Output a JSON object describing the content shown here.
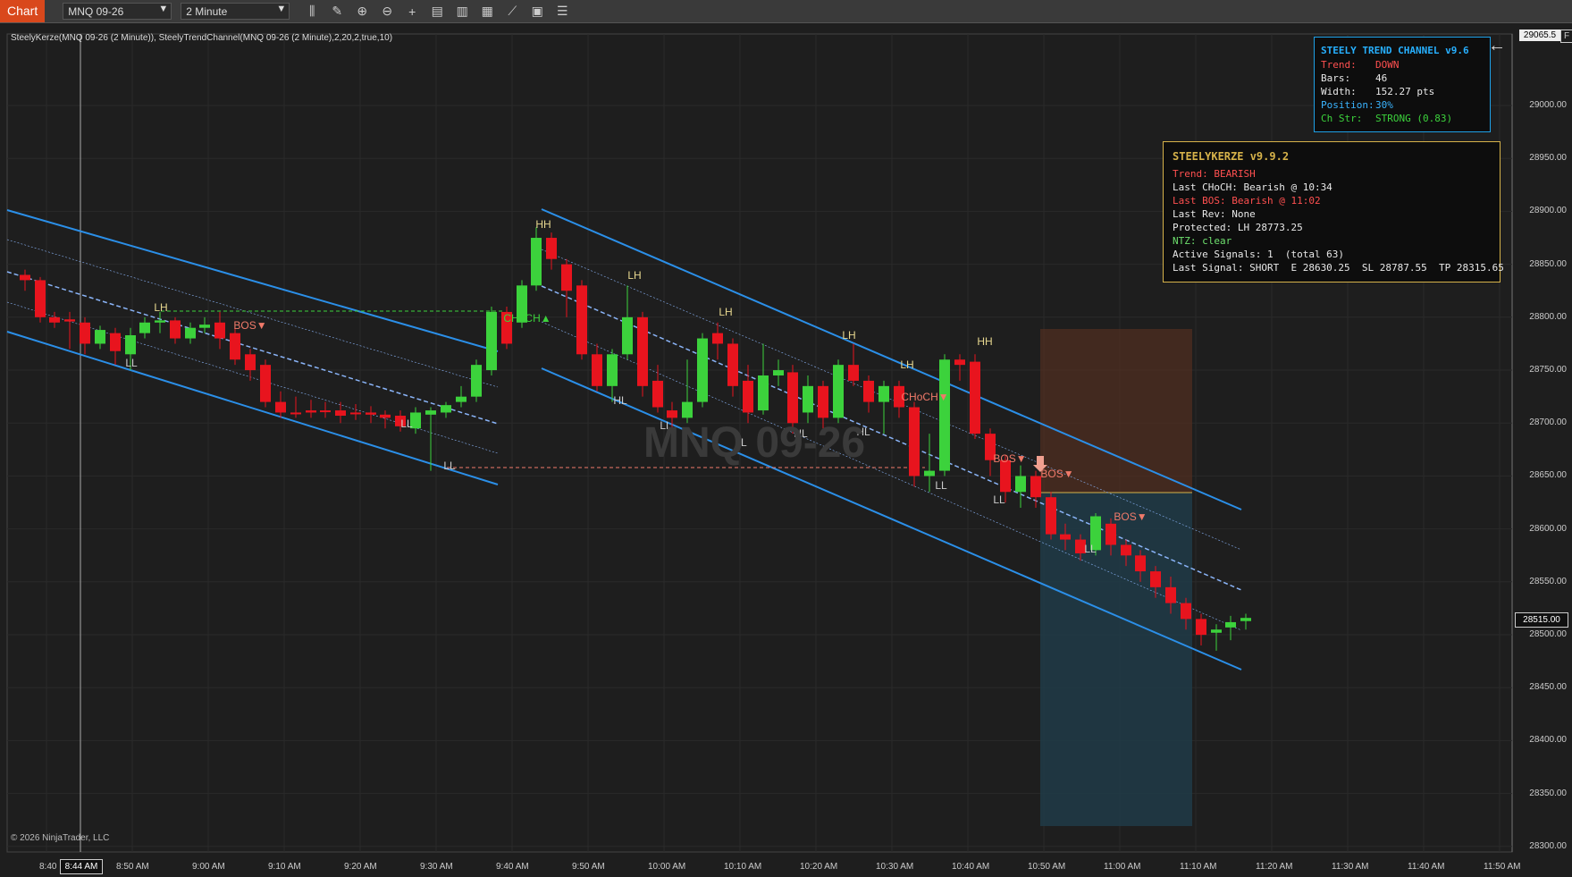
{
  "toolbar": {
    "tab": "Chart",
    "instrument": "MNQ 09-26",
    "interval": "2 Minute",
    "icons": [
      "bar-type-icon",
      "drawing-tool-icon",
      "zoom-in-icon",
      "zoom-out-icon",
      "crosshair-icon",
      "data-box-icon",
      "chart-trader-icon",
      "strategies-icon",
      "indicators-icon",
      "properties-icon",
      "templates-icon"
    ]
  },
  "chart": {
    "indicator_label": "SteelyKerze(MNQ 09-26 (2 Minute)), SteelyTrendChannel(MNQ 09-26 (2 Minute),2,20,2,true,10)",
    "watermark": "MNQ 09-26",
    "copyright": "© 2026 NinjaTrader, LLC",
    "current_price": "28515.00",
    "top_price_label": "29065.5",
    "collapse_label": "F",
    "cursor_time_label": "8:44 AM",
    "y_ticks": [
      "29000.00",
      "28950.00",
      "28900.00",
      "28850.00",
      "28800.00",
      "28750.00",
      "28700.00",
      "28650.00",
      "28600.00",
      "28550.00",
      "28500.00",
      "28450.00",
      "28400.00",
      "28350.00",
      "28300.00"
    ],
    "x_ticks": [
      "8:40",
      "8:50 AM",
      "9:00 AM",
      "9:10 AM",
      "9:20 AM",
      "9:30 AM",
      "9:40 AM",
      "9:50 AM",
      "10:00 AM",
      "10:10 AM",
      "10:20 AM",
      "10:30 AM",
      "10:40 AM",
      "10:50 AM",
      "11:00 AM",
      "11:10 AM",
      "11:20 AM",
      "11:30 AM",
      "11:40 AM",
      "11:50 AM"
    ],
    "colors": {
      "up": "#3cd23c",
      "down": "#e8141e",
      "channel": "#2b8fe8",
      "mid": "#8ab4f8"
    },
    "annotations": [
      {
        "text": "LH",
        "color": "#e8d890"
      },
      {
        "text": "LL",
        "color": "#ccc"
      },
      {
        "text": "BOS▼",
        "color": "#f07a6a"
      },
      {
        "text": "LL",
        "color": "#ccc"
      },
      {
        "text": "LL",
        "color": "#ccc"
      },
      {
        "text": "CHoCH▲",
        "color": "#3cd23c"
      },
      {
        "text": "HH",
        "color": "#e8d890"
      },
      {
        "text": "LH",
        "color": "#e8d890"
      },
      {
        "text": "HL",
        "color": "#ccc"
      },
      {
        "text": "LL",
        "color": "#ccc"
      },
      {
        "text": "LH",
        "color": "#e8d890"
      },
      {
        "text": "LL",
        "color": "#ccc"
      },
      {
        "text": "HL",
        "color": "#ccc"
      },
      {
        "text": "LH",
        "color": "#e8d890"
      },
      {
        "text": "HL",
        "color": "#ccc"
      },
      {
        "text": "LH",
        "color": "#e8d890"
      },
      {
        "text": "CHoCH▼",
        "color": "#f07a6a"
      },
      {
        "text": "LL",
        "color": "#ccc"
      },
      {
        "text": "HH",
        "color": "#e8d890"
      },
      {
        "text": "BOS▼",
        "color": "#f07a6a"
      },
      {
        "text": "LL",
        "color": "#ccc"
      },
      {
        "text": "BOS▼",
        "color": "#f07a6a"
      },
      {
        "text": "LL",
        "color": "#ccc"
      },
      {
        "text": "BOS▼",
        "color": "#f07a6a"
      }
    ]
  },
  "trend_channel": {
    "title": "STEELY TREND CHANNEL v9.6",
    "rows": [
      {
        "label": "Trend:",
        "value": "DOWN",
        "color": "#ff5050"
      },
      {
        "label": "Bars:",
        "value": "46",
        "color": "#e8e8e8"
      },
      {
        "label": "Width:",
        "value": "152.27 pts",
        "color": "#e8e8e8"
      },
      {
        "label": "Position:",
        "value": "30%",
        "color": "#3ab4ff"
      },
      {
        "label": "Ch Str:",
        "value": "STRONG (0.83)",
        "color": "#3cd23c"
      }
    ]
  },
  "kerze": {
    "title": "STEELYKERZE v9.9.2",
    "lines": [
      {
        "text": "Trend: BEARISH",
        "color": "#ff5050"
      },
      {
        "text": "Last CHoCH: Bearish @ 10:34",
        "color": "#e8e8e8"
      },
      {
        "text": "Last BOS: Bearish @ 11:02",
        "color": "#ff5050"
      },
      {
        "text": "Last Rev: None",
        "color": "#e8e8e8"
      },
      {
        "text": "Protected: LH 28773.25",
        "color": "#e8e8e8"
      },
      {
        "text": "NTZ: clear",
        "color": "#6ee06e"
      },
      {
        "text": "Active Signals: 1  (total 63)",
        "color": "#e8e8e8"
      },
      {
        "text": "Last Signal: SHORT  E 28630.25  SL 28787.55  TP 28315.65",
        "color": "#e8e8e8"
      }
    ]
  }
}
